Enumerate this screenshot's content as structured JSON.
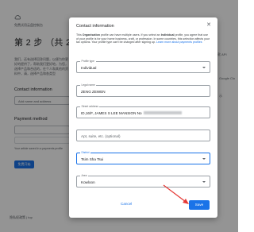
{
  "background": {
    "console_title": "免费试用云盘控制台",
    "step_heading": "第 2 步 （共 2 步）: 支",
    "description": "我们，还有选择回答问题，以便为你更好的提供了，帮助我们更好地，为您，选择产品和合适的，在个人和其他的资料中，请，选择产品和各类型",
    "contact_heading": "Contact information",
    "contact_button": "Add name and address",
    "payment_heading": "Payment method",
    "payment_note": "Your article saved in a payments profile",
    "submit_label": "免费开始",
    "footer_text": "隐私权政策 | top",
    "right_note_1": "付款 API",
    "right_note_2": "Google Clo",
    "right_note_3": "示"
  },
  "dialog": {
    "title": "Contact information",
    "close_icon": "close-icon",
    "info_text_1": "This ",
    "info_bold_1": "Organisation",
    "info_text_2": " profile can have multiple users. If you select an ",
    "info_bold_2": "Individual",
    "info_text_3": " profile, you agree that use of your profile is for your home business, craft, or profession. In some countries, this selection affects your tax options. Your profile type can't be changed after signing up. ",
    "info_link": "Learn more about payments profiles",
    "fields": {
      "profile_type": {
        "label": "Profile type",
        "value": "Individual"
      },
      "legal_name": {
        "label": "Legal name",
        "value": "ZENG ZEWEN"
      },
      "street_address": {
        "label": "Street address",
        "value": "ID,16/F, JAMES S LEE MANSION No"
      },
      "apt": {
        "placeholder": "Apt, suite, etc. (optional)"
      },
      "district": {
        "label": "District",
        "value": "Tsim Sha Tsui"
      },
      "area": {
        "label": "Area",
        "value": "Kowloon"
      }
    },
    "cancel_label": "Cancel",
    "save_label": "Save"
  },
  "colors": {
    "accent": "#1a73e8",
    "annotation_arrow": "#e53935"
  }
}
